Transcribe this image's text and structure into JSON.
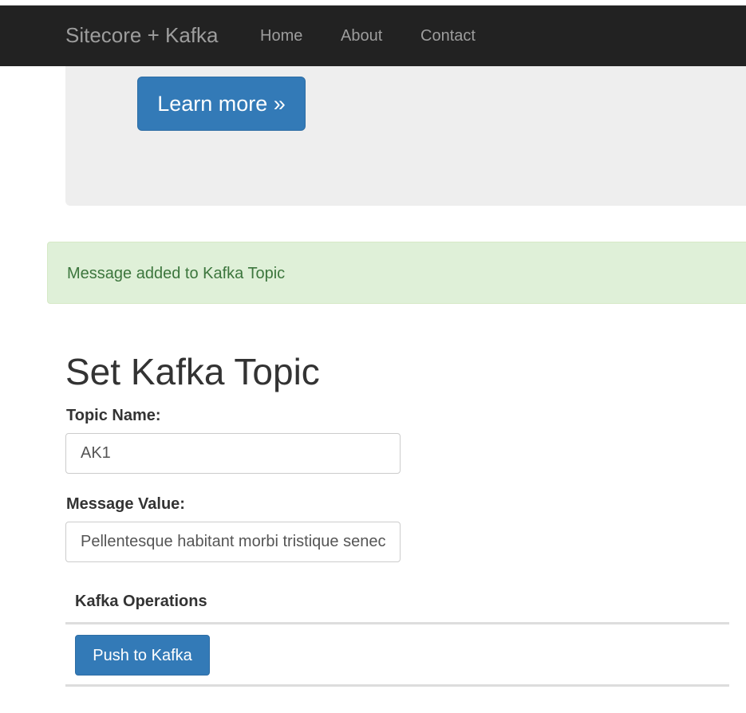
{
  "navbar": {
    "brand": "Sitecore + Kafka",
    "links": [
      "Home",
      "About",
      "Contact"
    ]
  },
  "jumbotron": {
    "button_label": "Learn more »"
  },
  "alert": {
    "message": "Message added to Kafka Topic",
    "type": "success"
  },
  "form": {
    "title": "Set Kafka Topic",
    "topic_label": "Topic Name:",
    "topic_value": "AK1",
    "message_label": "Message Value:",
    "message_value": "Pellentesque habitant morbi tristique senectus"
  },
  "operations": {
    "header": "Kafka Operations",
    "push_button_label": "Push to Kafka"
  },
  "colors": {
    "navbar_bg": "#222222",
    "primary": "#337ab7",
    "alert_bg": "#dff0d8",
    "alert_text": "#3c763d",
    "jumbotron_bg": "#eeeeee"
  }
}
